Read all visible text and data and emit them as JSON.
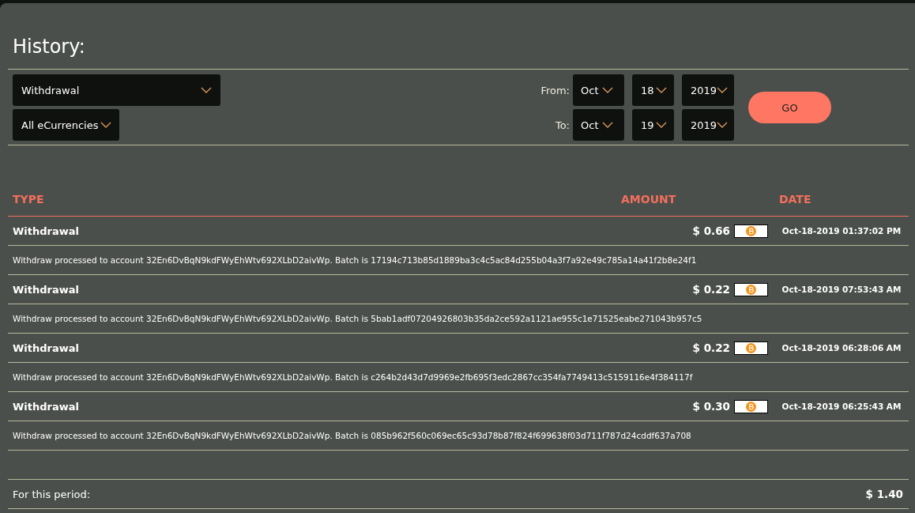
{
  "title": "History:",
  "filters": {
    "type_select": {
      "value": "Withdrawal"
    },
    "currency_select": {
      "value": "All eCurrencies"
    },
    "date_ranges": [
      {
        "label": "From:",
        "month": "Oct",
        "day": "18",
        "year": "2019"
      },
      {
        "label": "To:",
        "month": "Oct",
        "day": "19",
        "year": "2019"
      }
    ],
    "go_button": "GO"
  },
  "table": {
    "columns": [
      "TYPE",
      "AMOUNT",
      "DATE"
    ],
    "rows": [
      {
        "type": "Withdrawal",
        "amount": "$ 0.66",
        "date": "Oct-18-2019 01:37:02 PM",
        "description": "Withdraw processed to account 32En6DvBqN9kdFWyEhWtv692XLbD2aivWp. Batch is 17194c713b85d1889ba3c4c5ac84d255b04a3f7a92e49c785a14a41f2b8e24f1"
      },
      {
        "type": "Withdrawal",
        "amount": "$ 0.22",
        "date": "Oct-18-2019 07:53:43 AM",
        "description": "Withdraw processed to account 32En6DvBqN9kdFWyEhWtv692XLbD2aivWp. Batch is 5bab1adf07204926803b35da2ce592a1121ae955c1e71525eabe271043b957c5"
      },
      {
        "type": "Withdrawal",
        "amount": "$ 0.22",
        "date": "Oct-18-2019 06:28:06 AM",
        "description": "Withdraw processed to account 32En6DvBqN9kdFWyEhWtv692XLbD2aivWp. Batch is c264b2d43d7d9969e2fb695f3edc2867cc354fa7749413c5159116e4f384117f"
      },
      {
        "type": "Withdrawal",
        "amount": "$ 0.30",
        "date": "Oct-18-2019 06:25:43 AM",
        "description": "Withdraw processed to account 32En6DvBqN9kdFWyEhWtv692XLbD2aivWp. Batch is 085b962f560c069ec65c93d78b87f824f699638f03d711f787d24cddf637a708"
      }
    ]
  },
  "summary": {
    "label": "For this period:",
    "total": "$ 1.40"
  }
}
